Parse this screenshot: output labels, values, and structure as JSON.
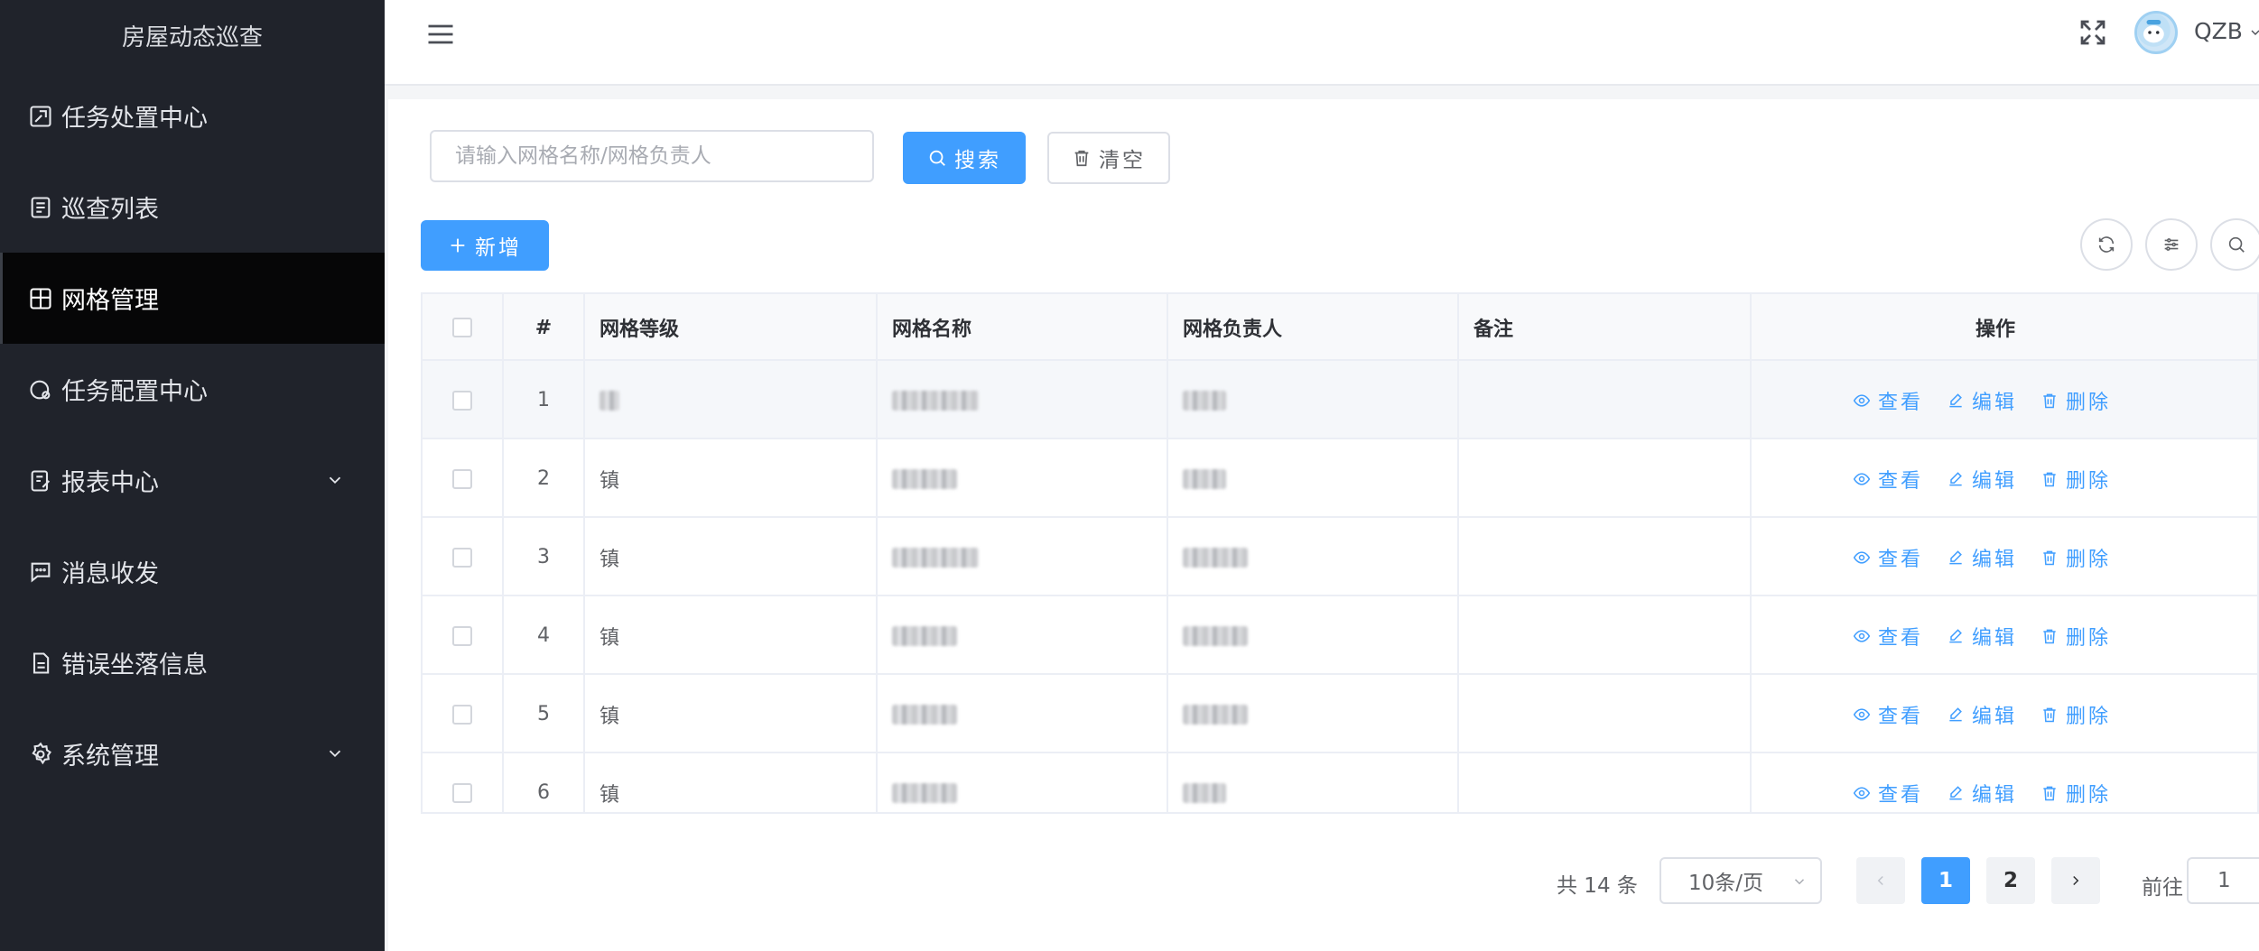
{
  "app": {
    "title": "房屋动态巡查"
  },
  "sidebar": {
    "items": [
      {
        "label": "任务处置中心",
        "icon": "task-handle-icon",
        "active": false,
        "expandable": false
      },
      {
        "label": "巡查列表",
        "icon": "list-icon",
        "active": false,
        "expandable": false
      },
      {
        "label": "网格管理",
        "icon": "grid-icon",
        "active": true,
        "expandable": false
      },
      {
        "label": "任务配置中心",
        "icon": "task-config-icon",
        "active": false,
        "expandable": false
      },
      {
        "label": "报表中心",
        "icon": "report-icon",
        "active": false,
        "expandable": true
      },
      {
        "label": "消息收发",
        "icon": "message-icon",
        "active": false,
        "expandable": false
      },
      {
        "label": "错误坐落信息",
        "icon": "document-icon",
        "active": false,
        "expandable": false
      },
      {
        "label": "系统管理",
        "icon": "settings-icon",
        "active": false,
        "expandable": true
      }
    ]
  },
  "header": {
    "username": "QZB"
  },
  "toolbar": {
    "search_placeholder": "请输入网格名称/网格负责人",
    "search_label": "搜索",
    "clear_label": "清空",
    "add_label": "新增"
  },
  "table": {
    "columns": [
      "#",
      "网格等级",
      "网格名称",
      "网格负责人",
      "备注",
      "操作"
    ],
    "rows": [
      {
        "index": "1",
        "level": "",
        "remark": ""
      },
      {
        "index": "2",
        "level": "镇",
        "remark": ""
      },
      {
        "index": "3",
        "level": "镇",
        "remark": ""
      },
      {
        "index": "4",
        "level": "镇",
        "remark": ""
      },
      {
        "index": "5",
        "level": "镇",
        "remark": ""
      },
      {
        "index": "6",
        "level": "镇",
        "remark": ""
      }
    ],
    "actions": {
      "view": "查看",
      "edit": "编辑",
      "delete": "删除"
    }
  },
  "pagination": {
    "total_text": "共 14 条",
    "page_size": "10条/页",
    "pages": [
      "1",
      "2"
    ],
    "current": "1",
    "goto_label": "前往",
    "goto_value": "1"
  },
  "colors": {
    "primary": "#409eff",
    "sidebar_bg": "#20232b",
    "active_item_bg": "#060607"
  }
}
